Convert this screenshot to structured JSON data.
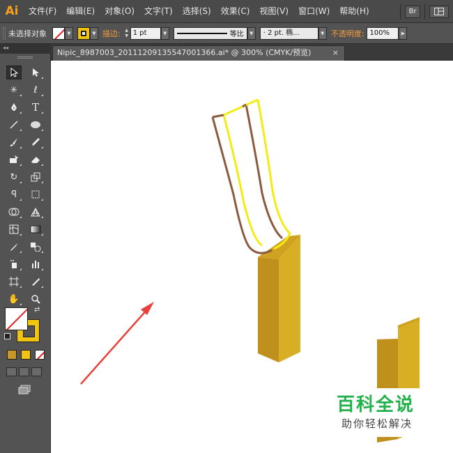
{
  "app": {
    "logo": "Ai"
  },
  "menu": [
    {
      "label": "文件(F)",
      "name": "menu-file"
    },
    {
      "label": "编辑(E)",
      "name": "menu-edit"
    },
    {
      "label": "对象(O)",
      "name": "menu-object"
    },
    {
      "label": "文字(T)",
      "name": "menu-type"
    },
    {
      "label": "选择(S)",
      "name": "menu-select"
    },
    {
      "label": "效果(C)",
      "name": "menu-effect"
    },
    {
      "label": "视图(V)",
      "name": "menu-view"
    },
    {
      "label": "窗口(W)",
      "name": "menu-window"
    },
    {
      "label": "帮助(H)",
      "name": "menu-help"
    }
  ],
  "menubar_right": {
    "bridge_label": "Br",
    "workspace_icon": "workspace-switcher-icon"
  },
  "control": {
    "selection_label": "未选择对象",
    "stroke_label": "描边:",
    "stroke_weight": "1 pt",
    "stroke_style_label": "等比",
    "brush_label": "· 2 pt. 椭...",
    "opacity_label": "不透明度:",
    "opacity_value": "100%"
  },
  "document": {
    "tab_title": "Nipic_8987003_20111209135547001366.ai* @ 300% (CMYK/预览)",
    "close_glyph": "×"
  },
  "tools": [
    "selection-tool",
    "direct-selection-tool",
    "magic-wand-tool",
    "lasso-tool",
    "pen-tool",
    "type-tool",
    "line-tool",
    "ellipse-tool",
    "paintbrush-tool",
    "pencil-tool",
    "blob-brush-tool",
    "eraser-tool",
    "rotate-tool",
    "scale-tool",
    "warp-tool",
    "free-transform-tool",
    "shape-builder-tool",
    "perspective-grid-tool",
    "mesh-tool",
    "gradient-tool",
    "eyedropper-tool",
    "blend-tool",
    "symbol-sprayer-tool",
    "column-graph-tool",
    "artboard-tool",
    "slice-tool",
    "hand-tool",
    "zoom-tool"
  ],
  "colors": {
    "accent_orange": "#f39c3c",
    "stroke_yellow": "#f1c40f",
    "brown_line": "#8b5a3c",
    "bright_yellow": "#f5ea14",
    "pillar_light": "#d7ae24",
    "pillar_dark": "#c0901d",
    "watermark_green": "#22b24c"
  },
  "watermark": {
    "title": "百科全说",
    "subtitle": "助你轻松解决"
  }
}
